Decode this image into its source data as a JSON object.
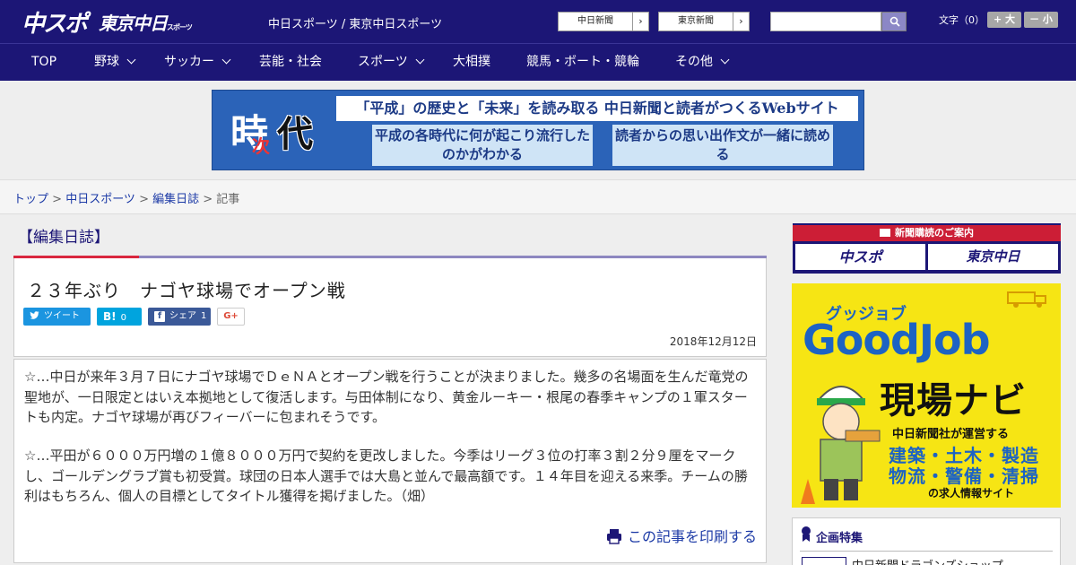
{
  "header": {
    "logo_chusupo": "中スポ",
    "logo_tokyo": "東京中日",
    "logo_tokyo_sub": "スポーツ",
    "site_links": "中日スポーツ / 東京中日スポーツ",
    "btn_chunichi": "中日新聞",
    "btn_tokyo": "東京新聞",
    "btn_arrow": "›",
    "font_label": "文字（0）",
    "font_plus": "+ 大",
    "font_minus": "－ 小"
  },
  "nav": {
    "items": [
      "TOP",
      "野球",
      "サッカー",
      "芸能・社会",
      "スポーツ",
      "大相撲",
      "競馬・ボート・競輪",
      "その他"
    ]
  },
  "banner": {
    "logo_a": "時",
    "logo_b": "次",
    "logo_c": "代",
    "headline": "「平成」の歴史と「未来」を読み取る 中日新聞と読者がつくるWebサイト",
    "box1": "平成の各時代に何が起こり流行したのかがわかる",
    "box2": "読者からの思い出作文が一緒に読める"
  },
  "breadcrumb": {
    "top": "トップ",
    "sep": " > ",
    "chusupo": "中日スポーツ",
    "diary": "編集日誌",
    "current": "記事"
  },
  "article": {
    "category": "【編集日誌】",
    "title": "２３年ぶり　ナゴヤ球場でオープン戦",
    "tweet": "ツイート",
    "hatena_icon": "B!",
    "hatena_count": "0",
    "fb_share": "シェア",
    "fb_count": "1",
    "gplus": "G+",
    "date": "2018年12月12日",
    "paragraphs": [
      "☆…中日が来年３月７日にナゴヤ球場でＤｅＮＡとオープン戦を行うことが決まりました。幾多の名場面を生んだ竜党の聖地が、一日限定とはいえ本拠地として復活します。与田体制になり、黄金ルーキー・根尾の春季キャンプの１軍スタートも内定。ナゴヤ球場が再びフィーバーに包まれそうです。",
      "☆…平田が６０００万円増の１億８０００万円で契約を更改しました。今季はリーグ３位の打率３割２分９厘をマークし、ゴールデングラブ賞も初受賞。球団の日本人選手では大島と並んで最高額です。１４年目を迎える来季。チームの勝利はもちろん、個人の目標としてタイトル獲得を掲げました。（畑）"
    ],
    "print": "この記事を印刷する"
  },
  "sidebar": {
    "sub_head": "新聞購読のご案内",
    "sub_chusupo": "中スポ",
    "sub_tokyo": "東京中日",
    "gj_small": "グッジョブ",
    "gj_big": "GoodJob",
    "gj_navi": "現場ナビ",
    "gj_op": "中日新聞社が運営する",
    "gj_j1": "建築・土木・製造",
    "gj_j2": "物流・警備・清掃",
    "gj_site": "の求人情報サイト",
    "feature_title": "企画特集",
    "feature_item": "中日新聞ドラゴンズショップ"
  },
  "colors": {
    "header_bg": "#1c1676",
    "accent_red": "#d9263e",
    "link_blue": "#1c3aa6",
    "twitter": "#1b95e0",
    "hatena": "#00a4de",
    "facebook": "#3b5998",
    "goodjob_yellow": "#f6e514"
  },
  "icons": [
    "search-icon",
    "chevron-down-icon",
    "twitter-icon",
    "hatena-icon",
    "facebook-icon",
    "gplus-icon",
    "print-icon",
    "newspaper-icon",
    "ribbon-icon"
  ]
}
